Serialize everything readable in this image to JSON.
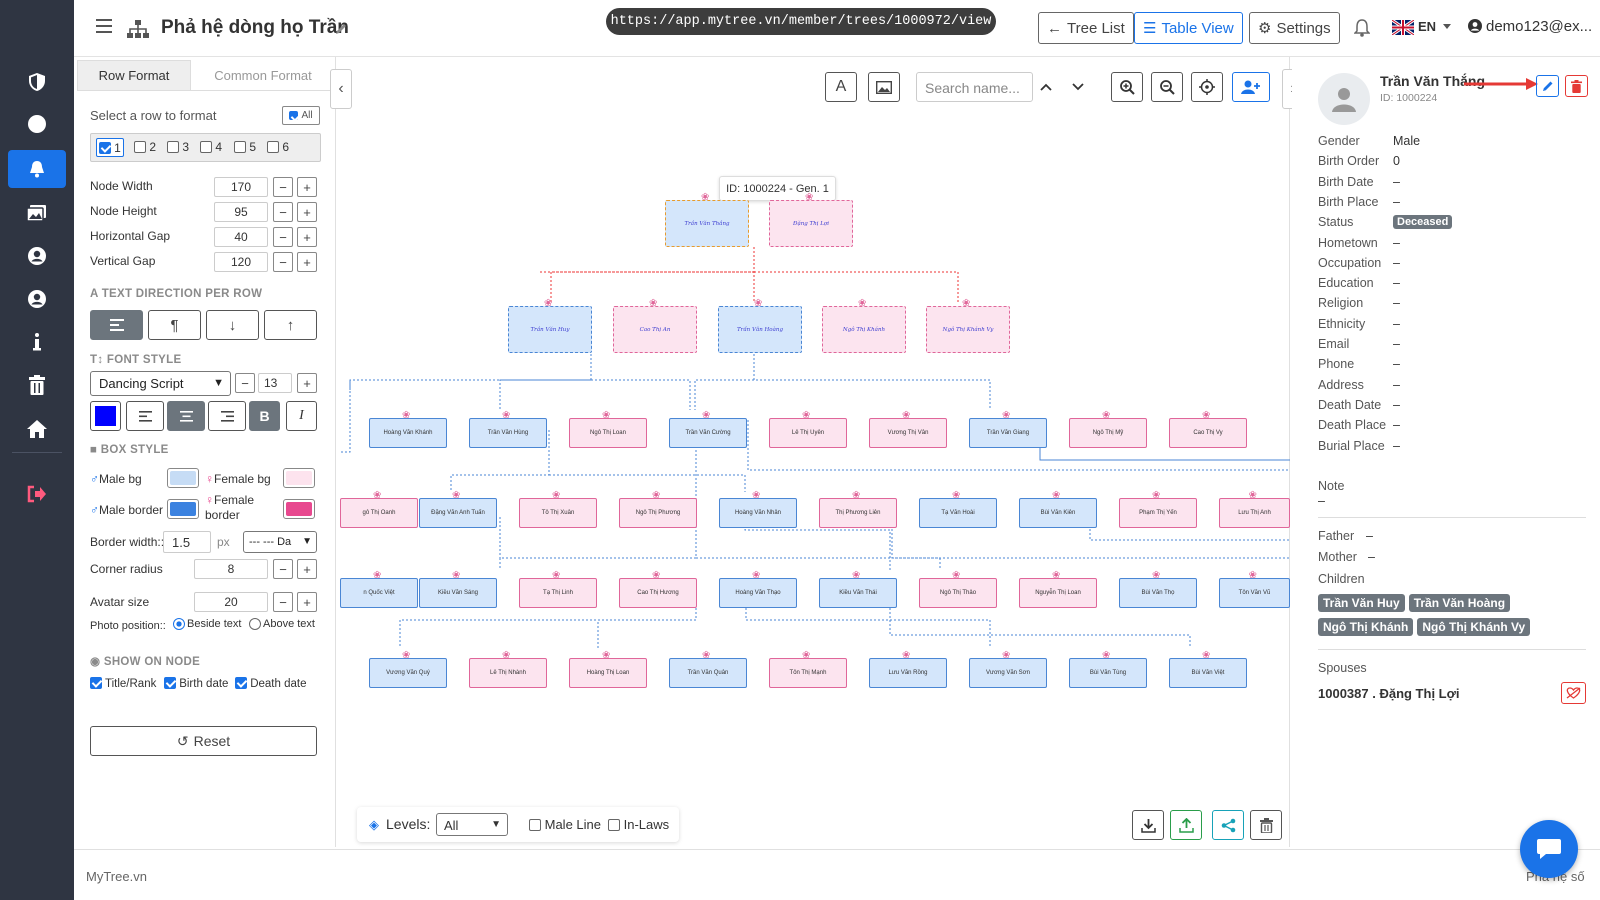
{
  "header": {
    "title": "Phả hệ dòng họ Trần",
    "url": "https://app.mytree.vn/member/trees/1000972/view",
    "tree_list": "Tree List",
    "table_view": "Table View",
    "settings": "Settings",
    "language": "EN",
    "user": "demo123@ex..."
  },
  "left_panel": {
    "tab_row_format": "Row Format",
    "tab_common_format": "Common Format",
    "select_row_label": "Select a row to format",
    "all_label": "All",
    "rows": [
      "1",
      "2",
      "3",
      "4",
      "5",
      "6"
    ],
    "node_width_label": "Node Width",
    "node_width": "170",
    "node_height_label": "Node Height",
    "node_height": "95",
    "hgap_label": "Horizontal Gap",
    "hgap": "40",
    "vgap_label": "Vertical Gap",
    "vgap": "120",
    "text_direction_head": "TEXT DIRECTION PER ROW",
    "font_style_head": "FONT STYLE",
    "font_family": "Dancing Script",
    "font_size": "13",
    "font_color": "#0000ff",
    "bold_label": "B",
    "italic_label": "I",
    "box_style_head": "BOX STYLE",
    "male_bg_label": "Male bg",
    "male_bg": "#c6dcf5",
    "female_bg_label": "Female bg",
    "female_bg": "#fde3ee",
    "male_border_label": "Male border",
    "male_border": "#3b82e0",
    "female_border_label": "Female border",
    "female_border": "#e8488f",
    "border_width_label": "Border width::",
    "border_width": "1.5",
    "px": "px",
    "border_style": "--- --- Da",
    "corner_radius_label": "Corner radius",
    "corner_radius": "8",
    "avatar_size_label": "Avatar size",
    "avatar_size": "20",
    "photo_position_label": "Photo position::",
    "beside_text": "Beside text",
    "above_text": "Above text",
    "show_on_node_head": "SHOW ON NODE",
    "title_rank": "Title/Rank",
    "birth_date": "Birth date",
    "death_date": "Death date",
    "reset": "Reset"
  },
  "canvas": {
    "search_placeholder": "Search name...",
    "tooltip": "ID: 1000224 - Gen. 1",
    "levels_label": "Levels:",
    "levels_value": "All",
    "male_line": "Male Line",
    "in_laws": "In-Laws",
    "nodes": {
      "g1": [
        "Trần Văn Thắng",
        "Đặng Thị Lợi"
      ],
      "g2": [
        "Trần Văn Huy",
        "Cao Thị An",
        "Trần Văn Hoàng",
        "Ngô Thị Khánh",
        "Ngô Thị Khánh Vy"
      ],
      "g3": [
        "Hoàng Văn Khánh",
        "Trần Văn Hùng",
        "Ngô Thị Loan",
        "Trần Văn Cường",
        "Lê Thị Uyên",
        "Vương Thị Vân",
        "Trần Văn Giang",
        "Ngô Thị Mỹ",
        "Cao Thị Vy"
      ],
      "g4": [
        "gô Thị Oanh",
        "Đặng Văn Anh Tuấn",
        "Tô Thị Xuân",
        "Ngô Thị Phương",
        "Hoàng Văn Nhân",
        "Thị Phương Liên",
        "Tạ Văn Hoài",
        "Bùi Văn Kiên",
        "Phạm Thị Yến",
        "Lưu Thị Anh"
      ],
      "g5": [
        "n Quốc Việt",
        "Kiều Văn Sáng",
        "Tạ Thị Linh",
        "Cao Thị Hương",
        "Hoàng Văn Thạo",
        "Kiều Văn Thái",
        "Ngô Thị Thảo",
        "Nguyễn Thị Loan",
        "Bùi Văn Thọ",
        "Tôn Văn Vũ"
      ],
      "g6": [
        "Vương Văn Quý",
        "Lê Thị Nhành",
        "Hoàng Thị Loan",
        "Trần Văn Quân",
        "Tôn Thị Mạnh",
        "Lưu Văn Rồng",
        "Vương Văn Sơn",
        "Bùi Văn Tùng",
        "Bùi Văn Việt"
      ]
    }
  },
  "right_panel": {
    "name": "Trần Văn Thắng",
    "id": "ID: 1000224",
    "fields": [
      {
        "k": "Gender",
        "v": "Male"
      },
      {
        "k": "Birth Order",
        "v": "0"
      },
      {
        "k": "Birth Date",
        "v": "–"
      },
      {
        "k": "Birth Place",
        "v": "–"
      },
      {
        "k": "Status",
        "v": "Deceased"
      },
      {
        "k": "Hometown",
        "v": "–"
      },
      {
        "k": "Occupation",
        "v": "–"
      },
      {
        "k": "Education",
        "v": "–"
      },
      {
        "k": "Religion",
        "v": "–"
      },
      {
        "k": "Ethnicity",
        "v": "–"
      },
      {
        "k": "Email",
        "v": "–"
      },
      {
        "k": "Phone",
        "v": "–"
      },
      {
        "k": "Address",
        "v": "–"
      },
      {
        "k": "Death Date",
        "v": "–"
      },
      {
        "k": "Death Place",
        "v": "–"
      },
      {
        "k": "Burial Place",
        "v": "–"
      }
    ],
    "note_label": "Note",
    "note_value": "–",
    "father_label": "Father",
    "father_value": "–",
    "mother_label": "Mother",
    "mother_value": "–",
    "children_label": "Children",
    "children": [
      "Trần Văn Huy",
      "Trần Văn Hoàng",
      "Ngô Thị Khánh",
      "Ngô Thị Khánh Vy"
    ],
    "spouses_label": "Spouses",
    "spouse": "1000387 . Đặng Thị Lợi"
  },
  "footer": {
    "brand": "MyTree.vn",
    "right": "Phả hệ số"
  }
}
